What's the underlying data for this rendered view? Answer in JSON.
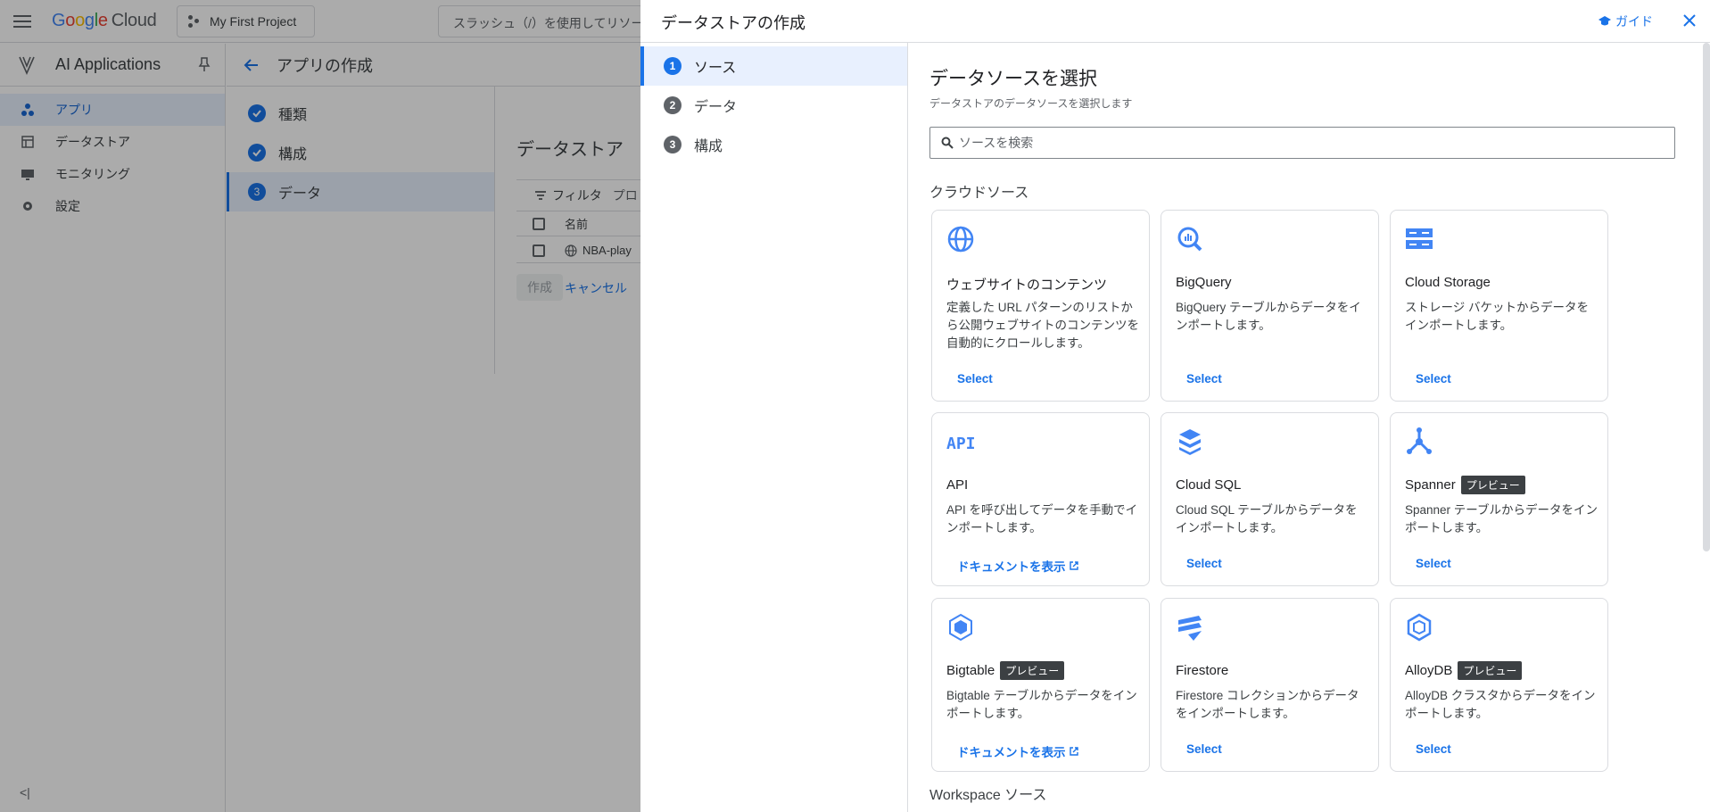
{
  "topbar": {
    "logo_letters": [
      "G",
      "o",
      "o",
      "g",
      "l",
      "e"
    ],
    "logo_cloud": "Cloud",
    "project": "My First Project",
    "search_placeholder": "スラッシュ（/）を使用してリソー"
  },
  "sidebar": {
    "product": "AI Applications",
    "items": [
      {
        "label": "アプリ",
        "icon": "apps-icon",
        "active": true
      },
      {
        "label": "データストア",
        "icon": "datastore-icon",
        "active": false
      },
      {
        "label": "モニタリング",
        "icon": "monitoring-icon",
        "active": false
      },
      {
        "label": "設定",
        "icon": "gear-icon",
        "active": false
      }
    ],
    "collapse": "<|"
  },
  "content": {
    "title": "アプリの作成",
    "steps": [
      {
        "label": "種類"
      },
      {
        "label": "構成"
      },
      {
        "number": "3",
        "label": "データ"
      }
    ],
    "datastore_title": "データストア",
    "filter_label": "フィルタ",
    "filter_hint": "プロ",
    "col_name": "名前",
    "row_name": "NBA-play",
    "create_label": "作成",
    "cancel_label": "キャンセル"
  },
  "panel": {
    "title": "データストアの作成",
    "guide_label": "ガイド",
    "steps": [
      {
        "number": "1",
        "label": "ソース"
      },
      {
        "number": "2",
        "label": "データ"
      },
      {
        "number": "3",
        "label": "構成"
      }
    ],
    "heading": "データソースを選択",
    "subheading": "データストアのデータソースを選択します",
    "search_placeholder": "ソースを検索",
    "section_cloud": "クラウドソース",
    "section_workspace": "Workspace ソース",
    "preview_label": "プレビュー",
    "cards": [
      {
        "title": "ウェブサイトのコンテンツ",
        "desc": "定義した URL パターンのリストから公開ウェブサイトのコンテンツを自動的にクロールします。",
        "action": "Select",
        "icon": "globe-icon"
      },
      {
        "title": "BigQuery",
        "desc": "BigQuery テーブルからデータをインポートします。",
        "action": "Select",
        "icon": "bigquery-icon"
      },
      {
        "title": "Cloud Storage",
        "desc": "ストレージ バケットからデータをインポートします。",
        "action": "Select",
        "icon": "cloud-storage-icon"
      },
      {
        "title": "API",
        "desc": "API を呼び出してデータを手動でインポートします。",
        "action": "ドキュメントを表示",
        "icon": "api-icon"
      },
      {
        "title": "Cloud SQL",
        "desc": "Cloud SQL テーブルからデータをインポートします。",
        "action": "Select",
        "icon": "cloud-sql-icon"
      },
      {
        "title": "Spanner",
        "desc": "Spanner テーブルからデータをインポートします。",
        "action": "Select",
        "icon": "spanner-icon"
      },
      {
        "title": "Bigtable",
        "desc": "Bigtable テーブルからデータをインポートします。",
        "action": "ドキュメントを表示",
        "icon": "bigtable-icon"
      },
      {
        "title": "Firestore",
        "desc": "Firestore コレクションからデータをインポートします。",
        "action": "Select",
        "icon": "firestore-icon"
      },
      {
        "title": "AlloyDB",
        "desc": "AlloyDB クラスタからデータをインポートします。",
        "action": "Select",
        "icon": "alloydb-icon"
      }
    ]
  },
  "colors": {
    "accent": "#1a73e8",
    "active_bg": "#e8f0fe",
    "badge_bg": "#3c4043",
    "icon_blue": "#4285f4"
  }
}
